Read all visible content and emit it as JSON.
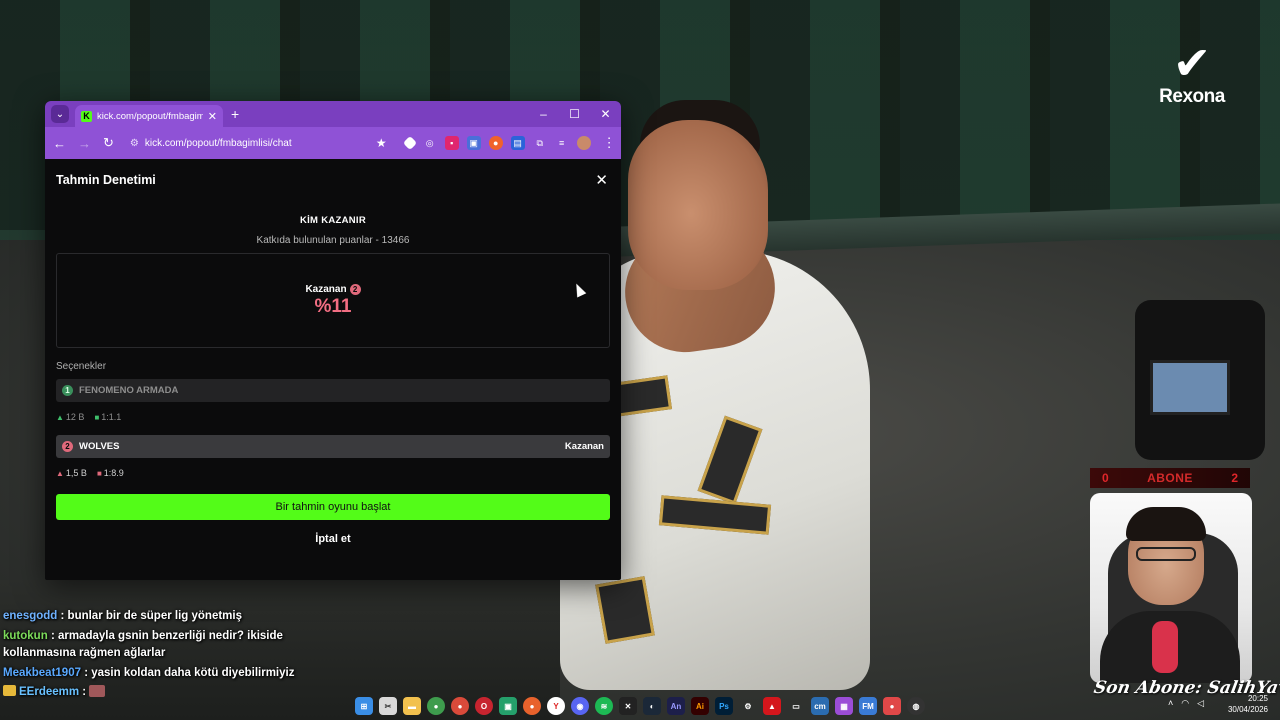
{
  "stream_overlay": {
    "sponsor_logo": "Rexona",
    "abone_counter": {
      "left": "0",
      "label": "ABONE",
      "right": "2"
    },
    "signature": "Son Abone: SalihYavuz"
  },
  "browser": {
    "tab_title": "kick.com/popout/fmbagimlisi/c",
    "url": "kick.com/popout/fmbagimlisi/chat",
    "window_controls": {
      "minimize": "–",
      "maximize": "☐",
      "close": "✕"
    }
  },
  "prediction": {
    "header_title": "Tahmin Denetimi",
    "question": "KİM KAZANIR",
    "points_text": "Katkıda bulunulan puanlar - 13466",
    "winner_label": "Kazanan",
    "winner_badge": "2",
    "winner_percent": "%11",
    "options_label": "Seçenekler",
    "options": [
      {
        "index": "1",
        "name": "FENOMENO ARMADA",
        "points": "12 B",
        "ratio": "1:1.1",
        "tag": ""
      },
      {
        "index": "2",
        "name": "WOLVES",
        "points": "1,5 B",
        "ratio": "1:8.9",
        "tag": "Kazanan"
      }
    ],
    "start_button": "Bir tahmin oyunu başlat",
    "cancel_button": "İptal et"
  },
  "chat": [
    {
      "user": "enesgodd",
      "text": ": bunlar bir de süper lig yönetmiş"
    },
    {
      "user": "kutokun",
      "text": ": armadayla gsnin benzerliği nedir? ikiside kollanmasına rağmen ağlarlar"
    },
    {
      "user": "Meakbeat1907",
      "text": ": yasin koldan daha kötü diyebilirmiyiz"
    },
    {
      "user": "EErdeemm",
      "text": ":"
    }
  ],
  "taskbar": {
    "apps": [
      "windows-start",
      "snipping-tool",
      "file-explorer",
      "chrome",
      "chrome-alt",
      "opera",
      "app-green",
      "firefox",
      "yandex",
      "discord",
      "spotify",
      "capcut",
      "steam",
      "adobe-animate",
      "adobe-illustrator",
      "adobe-photoshop",
      "settings",
      "acrobat",
      "camera",
      "cm-app",
      "app-purple",
      "fm-app",
      "recorder",
      "obs"
    ],
    "time": "20:25",
    "date": "30/04/2026"
  },
  "colors": {
    "kick_green": "#53fc18",
    "browser_purple": "#8f52d6",
    "winner_pink": "#f26e83"
  }
}
